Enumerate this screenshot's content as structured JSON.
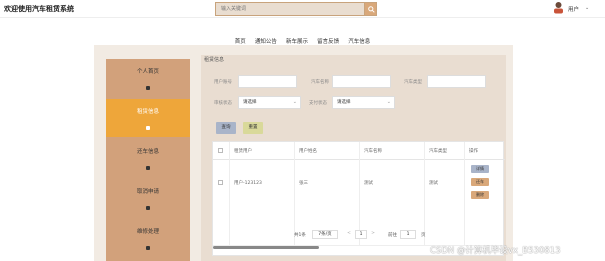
{
  "header": {
    "title": "欢迎使用汽车租赁系统",
    "search_placeholder": "输入关键词",
    "user_label": "用户"
  },
  "nav": [
    "首页",
    "通知公告",
    "新车展示",
    "留言反馈",
    "汽车信息"
  ],
  "sidebar": [
    {
      "label": "个人首页",
      "active": false
    },
    {
      "label": "租赁信息",
      "active": true
    },
    {
      "label": "还车信息",
      "active": false
    },
    {
      "label": "取消申请",
      "active": false
    },
    {
      "label": "维修处理",
      "active": false
    }
  ],
  "content": {
    "breadcrumb": "租赁信息",
    "filters": {
      "user_account_label": "用户账号",
      "car_name_label": "汽车名称",
      "car_type_label": "汽车类型",
      "review_status_label": "审核状态",
      "payment_status_label": "支付状态",
      "select_placeholder": "请选择"
    },
    "buttons": {
      "query": "查询",
      "reset": "重置"
    },
    "table": {
      "headers": [
        "租赁用户",
        "用户姓名",
        "汽车名称",
        "汽车类型",
        "操作"
      ],
      "rows": [
        {
          "user": "用户-123123",
          "name": "张三",
          "car_name": "测试",
          "car_type": "测试"
        }
      ],
      "row_actions": [
        "详情",
        "还车",
        "删除"
      ]
    },
    "pager": {
      "total_text": "共1条",
      "page_size": "7条/页",
      "prev": "<",
      "current": "1",
      "next": ">",
      "goto_label": "前往",
      "goto_value": "1",
      "goto_suffix": "页"
    }
  },
  "watermark": "CSDN @计算机毕设vx_B530813",
  "colors": {
    "sidebar": "#d2a17b",
    "sidebar_active": "#eea63a",
    "content_bg": "#e9ddd1",
    "query_button": "#a9b4c9",
    "reset_button": "#d9d99a",
    "action_detail": "#a9b4c9",
    "action_return": "#d9a87a",
    "action_delete": "#d9a87a"
  }
}
